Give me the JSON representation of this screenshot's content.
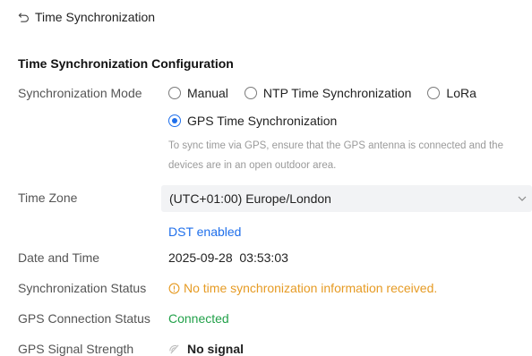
{
  "header": {
    "title": "Time Synchronization"
  },
  "section": {
    "title": "Time Synchronization Configuration"
  },
  "sync_mode": {
    "label": "Synchronization Mode",
    "options": [
      "Manual",
      "NTP Time Synchronization",
      "LoRa",
      "GPS Time Synchronization"
    ],
    "selected": "GPS Time Synchronization",
    "hint": "To sync time via GPS, ensure that the GPS antenna is connected and the devices are in an open outdoor area."
  },
  "time_zone": {
    "label": "Time Zone",
    "value": "(UTC+01:00) Europe/London",
    "dst_link": "DST enabled"
  },
  "date_time": {
    "label": "Date and Time",
    "value": "2025-09-28  03:53:03"
  },
  "sync_status": {
    "label": "Synchronization Status",
    "value": "No time synchronization information received."
  },
  "gps_connection": {
    "label": "GPS Connection Status",
    "value": "Connected"
  },
  "gps_signal": {
    "label": "GPS Signal Strength",
    "value": "No signal"
  },
  "colors": {
    "accent": "#1f6feb",
    "warning": "#e69b24",
    "success": "#22a14a",
    "hint": "#9a9a9a"
  },
  "icons": {
    "back": "back-arrow-icon",
    "warning": "warning-circle-icon",
    "signal": "no-signal-icon",
    "dropdown": "chevron-down-icon"
  }
}
